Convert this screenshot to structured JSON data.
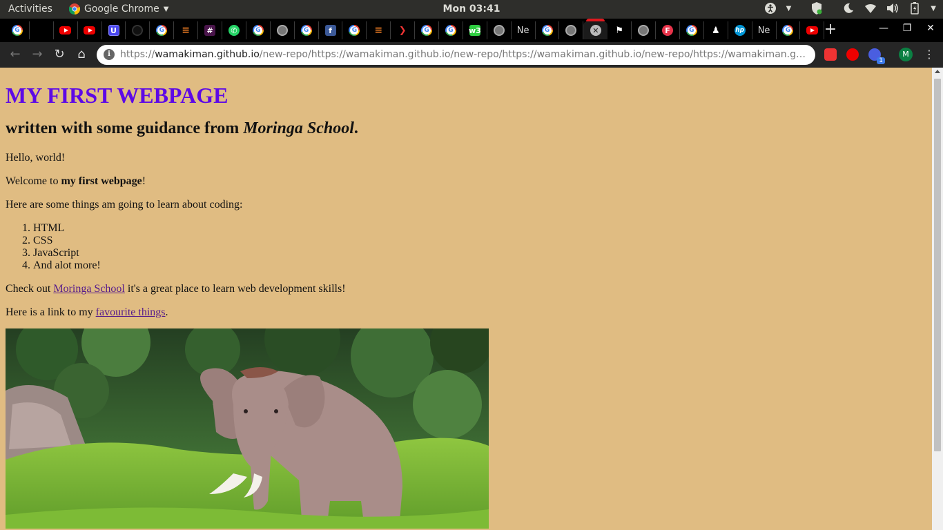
{
  "topbar": {
    "activities": "Activities",
    "app_name": "Google Chrome",
    "clock": "Mon 03:41",
    "tray_icons": [
      "accessibility-icon",
      "shield-update-icon",
      "night-light-icon",
      "wifi-icon",
      "volume-icon",
      "battery-icon",
      "power-menu-icon"
    ]
  },
  "tabs": [
    {
      "favicon": "google",
      "text": ""
    },
    {
      "favicon": "leaf",
      "text": ""
    },
    {
      "favicon": "youtube",
      "text": ""
    },
    {
      "favicon": "youtube",
      "text": ""
    },
    {
      "favicon": "udemy",
      "text": "U"
    },
    {
      "favicon": "github",
      "text": ""
    },
    {
      "favicon": "google",
      "text": ""
    },
    {
      "favicon": "so",
      "text": "≡"
    },
    {
      "favicon": "slack",
      "text": "#"
    },
    {
      "favicon": "whatsapp",
      "text": "✆"
    },
    {
      "favicon": "google",
      "text": ""
    },
    {
      "favicon": "globe",
      "text": ""
    },
    {
      "favicon": "google",
      "text": ""
    },
    {
      "favicon": "facebook",
      "text": "f"
    },
    {
      "favicon": "google",
      "text": ""
    },
    {
      "favicon": "so",
      "text": "≡"
    },
    {
      "favicon": "vs",
      "text": "❯"
    },
    {
      "favicon": "google",
      "text": ""
    },
    {
      "favicon": "google",
      "text": ""
    },
    {
      "favicon": "green",
      "text": "w3"
    },
    {
      "favicon": "globe",
      "text": ""
    },
    {
      "favicon": "ne",
      "text": "Ne"
    },
    {
      "favicon": "google",
      "text": ""
    },
    {
      "favicon": "globe",
      "text": ""
    },
    {
      "favicon": "close",
      "text": "✕",
      "active": true
    },
    {
      "favicon": "flag",
      "text": "⚑"
    },
    {
      "favicon": "globe",
      "text": ""
    },
    {
      "favicon": "fred",
      "text": "F"
    },
    {
      "favicon": "google",
      "text": ""
    },
    {
      "favicon": "tor",
      "text": "♟"
    },
    {
      "favicon": "hp",
      "text": "hp"
    },
    {
      "favicon": "ne",
      "text": "Ne"
    },
    {
      "favicon": "google",
      "text": ""
    },
    {
      "favicon": "youtube",
      "text": ""
    }
  ],
  "toolbar": {
    "url_scheme": "https://",
    "url_host": "wamakiman.github.io",
    "url_rest": "/new-repo/https://wamakiman.github.io/new-repo/https://wamakiman.github.io/new-repo/https://wamakiman.github.io/new-...",
    "profile_initial": "M",
    "extension_badge": "1"
  },
  "page": {
    "heading": "MY FIRST WEBPAGE",
    "subheading_prefix": "written with some guidance from ",
    "subheading_em": "Moringa School",
    "subheading_suffix": ".",
    "hello": "Hello, world!",
    "welcome_prefix": "Welcome to ",
    "welcome_bold": "my first webpage",
    "welcome_suffix": "!",
    "learn_intro": "Here are some things am going to learn about coding:",
    "learn_items": [
      "HTML",
      "CSS",
      "JavaScript",
      "And alot more!"
    ],
    "checkout_prefix": "Check out ",
    "checkout_link": "Moringa School",
    "checkout_suffix": " it's a great place to learn web development skills!",
    "fav_prefix": "Here is a link to my ",
    "fav_link": "favourite things",
    "fav_suffix": "."
  },
  "colors": {
    "page_background": "#e0bc82",
    "heading": "#5d09e6",
    "link": "#551a8b"
  }
}
